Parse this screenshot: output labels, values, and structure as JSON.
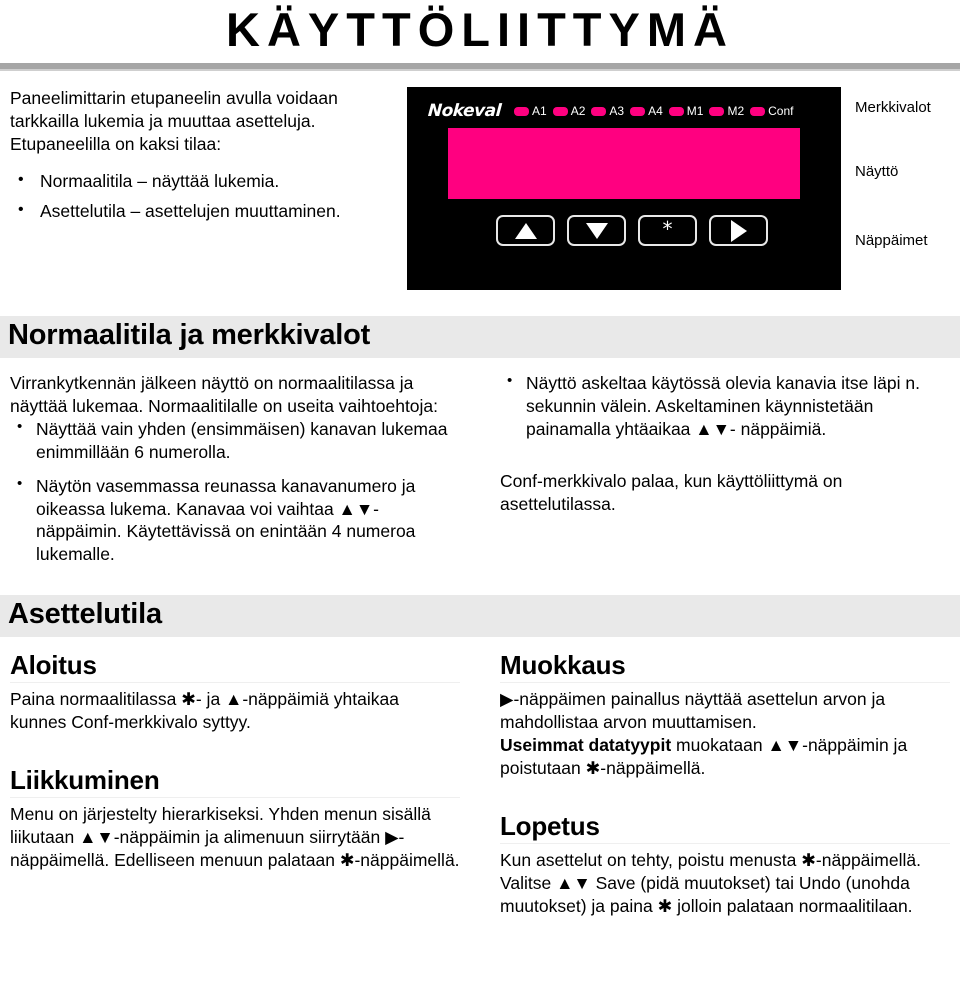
{
  "title": "KÄYTTÖLIITTYMÄ",
  "intro": {
    "paragraph": "Paneelimittarin etupaneelin avulla voidaan tarkkailla lukemia ja muuttaa asetteluja. Etupaneelilla on kaksi tilaa:",
    "bullets": [
      "Normaalitila – näyttää lukemia.",
      "Asettelutila – asettelujen muuttaminen."
    ]
  },
  "device": {
    "brand": "Nokeval",
    "led_labels": [
      "A1",
      "A2",
      "A3",
      "A4",
      "M1",
      "M2",
      "Conf"
    ],
    "led_color": "#ff0080",
    "display_color": "#ff0080",
    "panel_color": "#000000",
    "keys": [
      "up-arrow",
      "down-arrow",
      "asterisk",
      "right-arrow"
    ],
    "callouts": {
      "leds": "Merkkivalot",
      "display": "Näyttö",
      "keys": "Näppäimet"
    }
  },
  "section_normal": {
    "heading": "Normaalitila ja merkkivalot",
    "left_intro": "Virrankytkennän jälkeen näyttö on normaalitilassa ja näyttää lukemaa. Normaalitilalle on useita vaihtoehtoja:",
    "left_bullets": [
      "Näyttää vain yhden (ensimmäisen) kanavan lukemaa enimmillään 6 numerolla.",
      "Näytön vasemmassa reunassa kanavanumero ja oikeassa lukema. Kanavaa voi vaihtaa ▲▼-näppäimin. Käytettävissä on enintään 4 numeroa lukemalle."
    ],
    "right_bullets": [
      "Näyttö askeltaa käytössä olevia kanavia itse läpi n. sekunnin välein. Askeltaminen käynnistetään painamalla yhtäaikaa ▲▼- näppäimiä."
    ],
    "right_paragraph": "Conf-merkkivalo palaa, kun käyttöliittymä on asettelutilassa."
  },
  "section_settings": {
    "heading": "Asettelutila",
    "left": [
      {
        "subheading": "Aloitus",
        "body": "Paina normaalitilassa ✱- ja ▲-näppäimiä yhtaikaa kunnes Conf-merkkivalo syttyy."
      },
      {
        "subheading": "Liikkuminen",
        "body": "Menu on järjestelty hierarkiseksi. Yhden menun sisällä liikutaan ▲▼-näppäimin ja alimenuun siirrytään ▶-näppäimellä. Edelliseen menuun palataan ✱-näppäimellä."
      }
    ],
    "right": [
      {
        "subheading": "Muokkaus",
        "body_line1": "▶-näppäimen painallus näyttää asettelun arvon ja mahdollistaa arvon muuttamisen.",
        "body_bold": "Useimmat datatyypit",
        "body_line2": " muokataan ▲▼-näppäimin ja poistutaan ✱-näppäimellä."
      },
      {
        "subheading": "Lopetus",
        "body": "Kun asettelut on tehty, poistu menusta ✱-näppäimellä. Valitse ▲▼ Save (pidä muutokset) tai Undo (unohda muutokset) ja paina ✱ jolloin palataan  normaalitilaan."
      }
    ]
  }
}
